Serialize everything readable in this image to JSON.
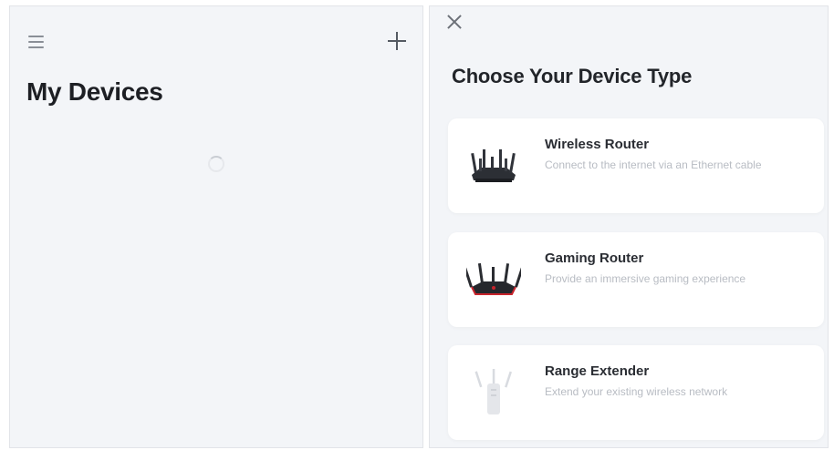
{
  "left_screen": {
    "title": "My Devices",
    "menu_icon": "hamburger-menu-icon",
    "add_icon": "plus-icon",
    "loading_icon": "spinner-icon"
  },
  "right_screen": {
    "close_icon": "close-icon",
    "title": "Choose Your Device Type",
    "devices": [
      {
        "name": "Wireless Router",
        "description": "Connect to the internet via an Ethernet cable",
        "icon": "wireless-router-icon"
      },
      {
        "name": "Gaming Router",
        "description": "Provide an immersive gaming experience",
        "icon": "gaming-router-icon"
      },
      {
        "name": "Range Extender",
        "description": "Extend your existing wireless network",
        "icon": "range-extender-icon"
      }
    ]
  },
  "colors": {
    "screen_background": "#f3f5f8",
    "card_background": "#ffffff",
    "title_text": "#1d1f24",
    "description_text": "#b8bcc3",
    "gaming_accent": "#c8242c"
  }
}
